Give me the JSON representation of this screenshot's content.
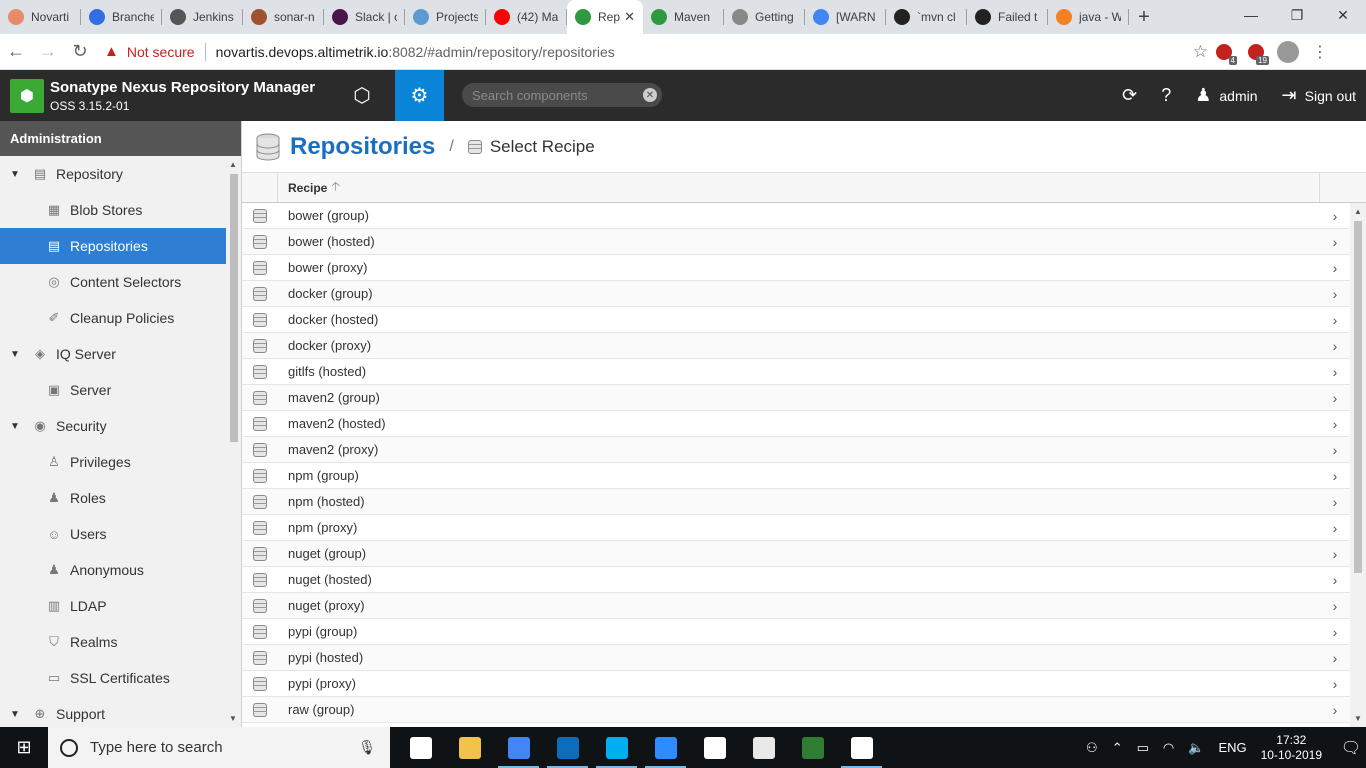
{
  "browser": {
    "tabs": [
      {
        "title": "Novarti",
        "color": "#e88b6b"
      },
      {
        "title": "Branche",
        "color": "#2f6fe0"
      },
      {
        "title": "Jenkins",
        "color": "#555555"
      },
      {
        "title": "sonar-n",
        "color": "#a0522d"
      },
      {
        "title": "Slack | c",
        "color": "#4a154b"
      },
      {
        "title": "Projects",
        "color": "#5b9bd5"
      },
      {
        "title": "(42) Ma",
        "color": "#ff0000"
      },
      {
        "title": "Rep",
        "color": "#2e9a3e",
        "active": true
      },
      {
        "title": "Maven",
        "color": "#2e9a3e"
      },
      {
        "title": "Getting",
        "color": "#888888"
      },
      {
        "title": "[WARN",
        "color": "#4285f4"
      },
      {
        "title": "`mvn cl",
        "color": "#222222"
      },
      {
        "title": "Failed t",
        "color": "#222222"
      },
      {
        "title": "java - W",
        "color": "#f48024"
      }
    ],
    "close_glyph": "✕",
    "new_tab": "+",
    "window_controls": {
      "minimize": "—",
      "maximize": "❐",
      "close": "✕"
    },
    "nav": {
      "back": "←",
      "forward": "→",
      "reload": "↻"
    },
    "security_warning": "Not secure",
    "url_host": "novartis.devops.altimetrik.io",
    "url_rest": ":8082/#admin/repository/repositories",
    "extensions": [
      {
        "badge": "4"
      },
      {
        "badge": "19"
      }
    ],
    "menu_glyph": "⋮"
  },
  "app": {
    "name": "Sonatype Nexus Repository Manager",
    "version": "OSS 3.15.2-01",
    "search_placeholder": "Search components",
    "user": "admin",
    "sign_out": "Sign out"
  },
  "sidebar": {
    "title": "Administration",
    "items": [
      {
        "label": "Repository",
        "level": 0,
        "icon": "database-icon",
        "glyph": "▤"
      },
      {
        "label": "Blob Stores",
        "level": 1,
        "icon": "blob-store-icon",
        "glyph": "▦"
      },
      {
        "label": "Repositories",
        "level": 1,
        "icon": "database-icon",
        "glyph": "▤",
        "selected": true
      },
      {
        "label": "Content Selectors",
        "level": 1,
        "icon": "content-selector-icon",
        "glyph": "◎"
      },
      {
        "label": "Cleanup Policies",
        "level": 1,
        "icon": "broom-icon",
        "glyph": "✐"
      },
      {
        "label": "IQ Server",
        "level": 0,
        "icon": "iq-server-icon",
        "glyph": "◈"
      },
      {
        "label": "Server",
        "level": 1,
        "icon": "server-icon",
        "glyph": "▣"
      },
      {
        "label": "Security",
        "level": 0,
        "icon": "security-icon",
        "glyph": "◉"
      },
      {
        "label": "Privileges",
        "level": 1,
        "icon": "medal-icon",
        "glyph": "♙"
      },
      {
        "label": "Roles",
        "level": 1,
        "icon": "role-icon",
        "glyph": "♟"
      },
      {
        "label": "Users",
        "level": 1,
        "icon": "users-icon",
        "glyph": "☺"
      },
      {
        "label": "Anonymous",
        "level": 1,
        "icon": "anonymous-icon",
        "glyph": "♟"
      },
      {
        "label": "LDAP",
        "level": 1,
        "icon": "ldap-icon",
        "glyph": "▥"
      },
      {
        "label": "Realms",
        "level": 1,
        "icon": "shield-icon",
        "glyph": "⛉"
      },
      {
        "label": "SSL Certificates",
        "level": 1,
        "icon": "certificate-icon",
        "glyph": "▭"
      },
      {
        "label": "Support",
        "level": 0,
        "icon": "support-icon",
        "glyph": "⊕"
      }
    ]
  },
  "main": {
    "title": "Repositories",
    "separator": "/",
    "subtitle": "Select Recipe",
    "column_header": "Recipe",
    "sort_glyph": "🡡",
    "row_arrow": "›",
    "recipes": [
      "bower (group)",
      "bower (hosted)",
      "bower (proxy)",
      "docker (group)",
      "docker (hosted)",
      "docker (proxy)",
      "gitlfs (hosted)",
      "maven2 (group)",
      "maven2 (hosted)",
      "maven2 (proxy)",
      "npm (group)",
      "npm (hosted)",
      "npm (proxy)",
      "nuget (group)",
      "nuget (hosted)",
      "nuget (proxy)",
      "pypi (group)",
      "pypi (hosted)",
      "pypi (proxy)",
      "raw (group)"
    ]
  },
  "taskbar": {
    "search_placeholder": "Type here to search",
    "apps": [
      {
        "name": "task-view",
        "color": "#ffffff"
      },
      {
        "name": "file-explorer",
        "color": "#f2c34a"
      },
      {
        "name": "chrome",
        "color": "#4285f4",
        "open": true
      },
      {
        "name": "outlook",
        "color": "#0f6cbd",
        "open": true
      },
      {
        "name": "skype",
        "color": "#00aff0",
        "open": true
      },
      {
        "name": "zoom",
        "color": "#2d8cff",
        "open": true
      },
      {
        "name": "sticky-notes",
        "color": "#ffffff"
      },
      {
        "name": "notepad",
        "color": "#e8e8e8"
      },
      {
        "name": "excel-like",
        "color": "#2f7d32"
      },
      {
        "name": "photos",
        "color": "#ffffff",
        "open": true
      }
    ],
    "language": "ENG",
    "time": "17:32",
    "date": "10-10-2019"
  }
}
